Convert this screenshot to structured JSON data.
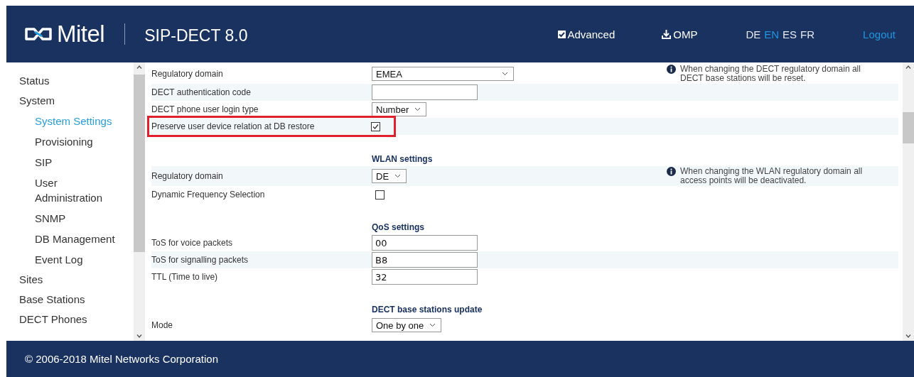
{
  "header": {
    "logo": "Mitel",
    "product": "SIP-DECT 8.0",
    "advanced": {
      "label": "Advanced",
      "checked": true
    },
    "download": "OMP",
    "languages": [
      {
        "code": "DE",
        "selected": false
      },
      {
        "code": "EN",
        "selected": true
      },
      {
        "code": "ES",
        "selected": false
      },
      {
        "code": "FR",
        "selected": false
      }
    ],
    "logout": "Logout"
  },
  "sidebar": {
    "items": [
      {
        "label": "Status",
        "selected": false
      },
      {
        "label": "System",
        "selected": false,
        "children": [
          {
            "label": "System Settings",
            "selected": true
          },
          {
            "label": "Provisioning",
            "selected": false
          },
          {
            "label": "SIP",
            "selected": false
          },
          {
            "label": "User Administration",
            "selected": false
          },
          {
            "label": "SNMP",
            "selected": false
          },
          {
            "label": "DB Management",
            "selected": false
          },
          {
            "label": "Event Log",
            "selected": false
          }
        ]
      },
      {
        "label": "Sites",
        "selected": false
      },
      {
        "label": "Base Stations",
        "selected": false
      },
      {
        "label": "DECT Phones",
        "selected": false
      }
    ]
  },
  "form": {
    "rows": [
      {
        "kind": "select",
        "label": "Regulatory domain",
        "value": "EMEA",
        "wide": true,
        "info": "When changing the DECT regulatory domain all DECT base stations will be reset.",
        "highlighted": false
      },
      {
        "kind": "text",
        "label": "DECT authentication code",
        "value": "",
        "highlighted": false
      },
      {
        "kind": "select",
        "label": "DECT phone user login type",
        "value": "Number",
        "wide": false,
        "highlighted": false
      },
      {
        "kind": "checkbox",
        "label": "Preserve user device relation at DB restore",
        "checked": true,
        "highlighted": true
      },
      {
        "kind": "heading",
        "label": "WLAN settings"
      },
      {
        "kind": "select",
        "label": "Regulatory domain",
        "value": "DE",
        "wide": false,
        "info": "When changing the WLAN regulatory domain all access points will be deactivated.",
        "highlighted": false
      },
      {
        "kind": "checkbox",
        "label": "Dynamic Frequency Selection",
        "checked": false,
        "highlighted": false
      },
      {
        "kind": "heading",
        "label": "QoS settings"
      },
      {
        "kind": "text",
        "label": "ToS for voice packets",
        "value": "00",
        "highlighted": false
      },
      {
        "kind": "text",
        "label": "ToS for signalling packets",
        "value": "B8",
        "highlighted": false
      },
      {
        "kind": "text",
        "label": "TTL (Time to live)",
        "value": "32",
        "highlighted": false
      },
      {
        "kind": "heading",
        "label": "DECT base stations update"
      },
      {
        "kind": "select",
        "label": "Mode",
        "value": "One by one",
        "wide": false,
        "highlighted": false
      }
    ]
  },
  "footer": "© 2006-2018 Mitel Networks Corporation"
}
